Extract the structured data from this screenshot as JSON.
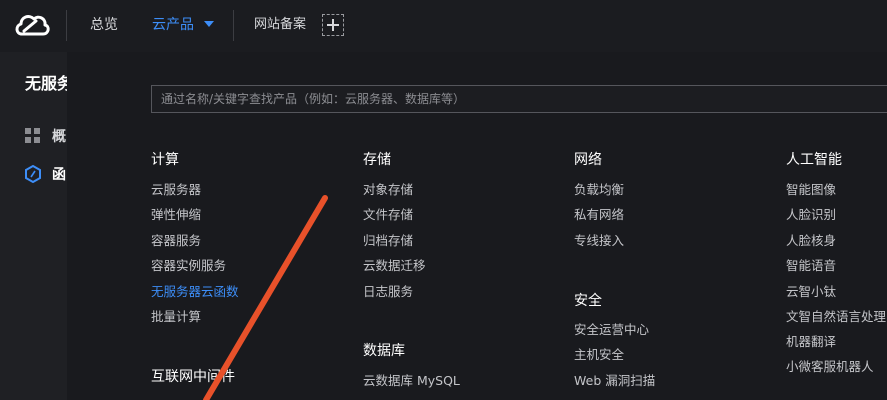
{
  "header": {
    "nav": {
      "overview": "总览",
      "products": "云产品",
      "icp": "网站备案"
    }
  },
  "sidebar": {
    "title": "无服务",
    "items": [
      {
        "label": "概",
        "icon": "grid-icon"
      },
      {
        "label": "函",
        "icon": "hexagon-icon"
      }
    ]
  },
  "panel": {
    "search_placeholder": "通过名称/关键字查找产品（例如：云服务器、数据库等）",
    "categories": {
      "compute": {
        "title": "计算",
        "items": [
          "云服务器",
          "弹性伸缩",
          "容器服务",
          "容器实例服务",
          "无服务器云函数",
          "批量计算"
        ]
      },
      "middleware": {
        "title": "互联网中间件"
      },
      "storage": {
        "title": "存储",
        "items": [
          "对象存储",
          "文件存储",
          "归档存储",
          "云数据迁移",
          "日志服务"
        ]
      },
      "database": {
        "title": "数据库",
        "items": [
          "云数据库 MySQL"
        ]
      },
      "network": {
        "title": "网络",
        "items": [
          "负载均衡",
          "私有网络",
          "专线接入"
        ]
      },
      "security": {
        "title": "安全",
        "items": [
          "安全运营中心",
          "主机安全",
          "Web 漏洞扫描"
        ]
      },
      "ai": {
        "title": "人工智能",
        "items": [
          "智能图像",
          "人脸识别",
          "人脸核身",
          "智能语音",
          "云智小钛",
          "文智自然语言处理",
          "机器翻译",
          "小微客服机器人"
        ]
      }
    },
    "active_item": "无服务器云函数"
  },
  "colors": {
    "accent": "#3d8ef8",
    "arrow": "#e8512a"
  }
}
